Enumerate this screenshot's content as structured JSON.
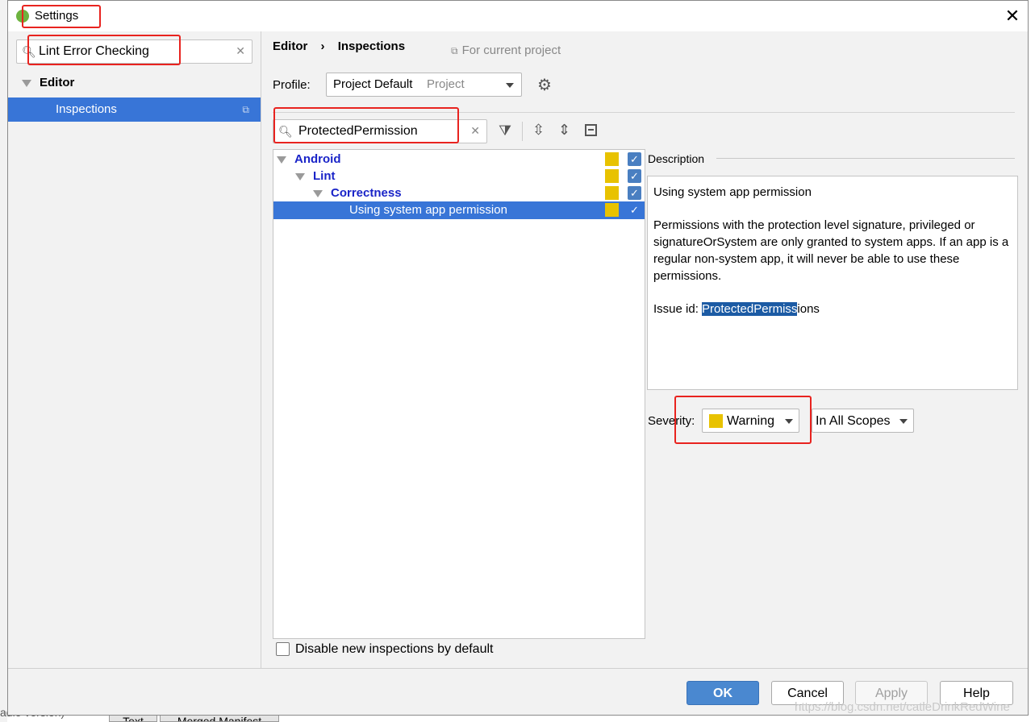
{
  "window": {
    "title": "Settings",
    "close_glyph": "✕"
  },
  "sidebar": {
    "search_value": "Lint Error Checking",
    "items": [
      {
        "label": "Editor"
      },
      {
        "label": "Inspections"
      }
    ]
  },
  "header": {
    "breadcrumb": [
      "Editor",
      "Inspections"
    ],
    "separator": "›",
    "scope_note": "For current project"
  },
  "profile": {
    "label": "Profile:",
    "value": "Project Default",
    "value_suffix": "Project"
  },
  "filter": {
    "search_value": "ProtectedPermission"
  },
  "tree": {
    "rows": [
      {
        "label": "Android"
      },
      {
        "label": "Lint"
      },
      {
        "label": "Correctness"
      },
      {
        "label": "Using system app permission"
      }
    ]
  },
  "description": {
    "header": "Description",
    "title": "Using system app permission",
    "body": "Permissions with the protection level signature, privileged or signatureOrSystem are only granted to system apps. If an app is a regular non-system app, it will never be able to use these permissions.",
    "issue_label": "Issue id: ",
    "issue_highlight": "ProtectedPermiss",
    "issue_rest": "ions"
  },
  "severity": {
    "label": "Severity:",
    "value": "Warning",
    "scope": "In All Scopes",
    "color": "#e8c200"
  },
  "options": {
    "disable_new": "Disable new inspections by default"
  },
  "buttons": {
    "ok": "OK",
    "cancel": "Cancel",
    "apply": "Apply",
    "help": "Help"
  },
  "watermark": "https://blog.csdn.net/catleDrinkRedWine",
  "background_ide": {
    "tab1": "Text",
    "tab2": "Merged Manifest",
    "side_text": "adle version)"
  },
  "colors": {
    "selection": "#3875d7",
    "ok_button": "#4a88d0",
    "highlight_box": "#e8231f",
    "tree_blue": "#1a24c8"
  }
}
